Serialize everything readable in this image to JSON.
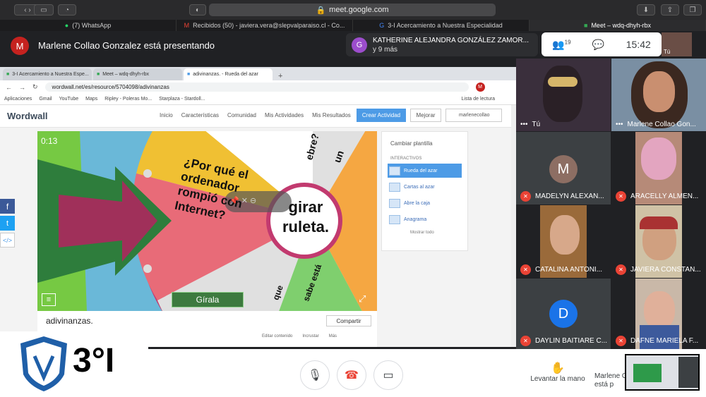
{
  "safari": {
    "url": "meet.google.com"
  },
  "safari_tabs": [
    "(7) WhatsApp",
    "Recibidos (50) - javiera.vera@slepvalparaiso.cl - Co...",
    "3-I Acercamiento a Nuestra Especialidad",
    "Meet – wdq-dhyh-rbx"
  ],
  "presenting": {
    "initial": "M",
    "text": "Marlene Collao Gonzalez está presentando"
  },
  "toast": {
    "initial": "G",
    "name": "KATHERINE ALEJANDRA GONZÁLEZ ZAMOR...",
    "more": "y 9 más"
  },
  "meet_controls": {
    "people_count": "19",
    "time": "15:42",
    "self": "Tú"
  },
  "chrome": {
    "tabs": [
      "3-I Acercamiento a Nuestra Espe...",
      "Meet – wdq-dhyh-rbx",
      "adivinanzas. - Rueda del azar"
    ],
    "address": "wordwall.net/es/resource/5704098/adivinanzas",
    "avatar": "M",
    "bookmarks": [
      "Aplicaciones",
      "Gmail",
      "YouTube",
      "Maps",
      "Ripley - Poleras Mo...",
      "Starplaza - Stardoll...",
      "Lista de lectura"
    ]
  },
  "wordwall": {
    "logo": "Wordwall",
    "nav": [
      "Inicio",
      "Características",
      "Comunidad",
      "Mis Actividades",
      "Mis Resultados"
    ],
    "create": "Crear Actividad",
    "upgrade": "Mejorar",
    "user": "marlenecollao"
  },
  "game": {
    "timer": "0:13",
    "question": "¿Por qué el ordenador rompió con Internet?",
    "center": "girar ruleta.",
    "spin": "Gírala",
    "top_text_1": "un",
    "top_text_2": "ebre?",
    "bottom_text": "sabe está",
    "bottom_text_2": "que"
  },
  "panel": {
    "title": "Cambiar plantilla",
    "section": "INTERACTIVOS",
    "items": [
      "Rueda del azar",
      "Cartas al azar",
      "Abre la caja",
      "Anagrama"
    ],
    "more": "Mostrar todo"
  },
  "activity": {
    "title": "adivinanzas.",
    "share": "Compartir",
    "actions": [
      "Editar contenido",
      "Incrustar",
      "Más"
    ]
  },
  "participants": [
    {
      "name": "Tú",
      "muted": false
    },
    {
      "name": "Marlene Collao Gon...",
      "muted": false
    },
    {
      "name": "MADELYN ALEXAN...",
      "initial": "M",
      "muted": true
    },
    {
      "name": "ARACELLY ALMEN...",
      "muted": true
    },
    {
      "name": "CATALINA ANTONI...",
      "muted": true
    },
    {
      "name": "JAVIERA CONSTAN...",
      "muted": true
    },
    {
      "name": "DAYLIN BAITIARE C...",
      "initial": "D",
      "muted": true
    },
    {
      "name": "DAFNE MARIELA F...",
      "muted": true
    }
  ],
  "logo": {
    "class": "3°I"
  },
  "bottom": {
    "raise_hand": "Levantar la mano",
    "presenter": "Marlene C",
    "presenter_2": "está p"
  },
  "colors": {
    "meet_red": "#ea4335",
    "ww_blue": "#4d9be6"
  }
}
